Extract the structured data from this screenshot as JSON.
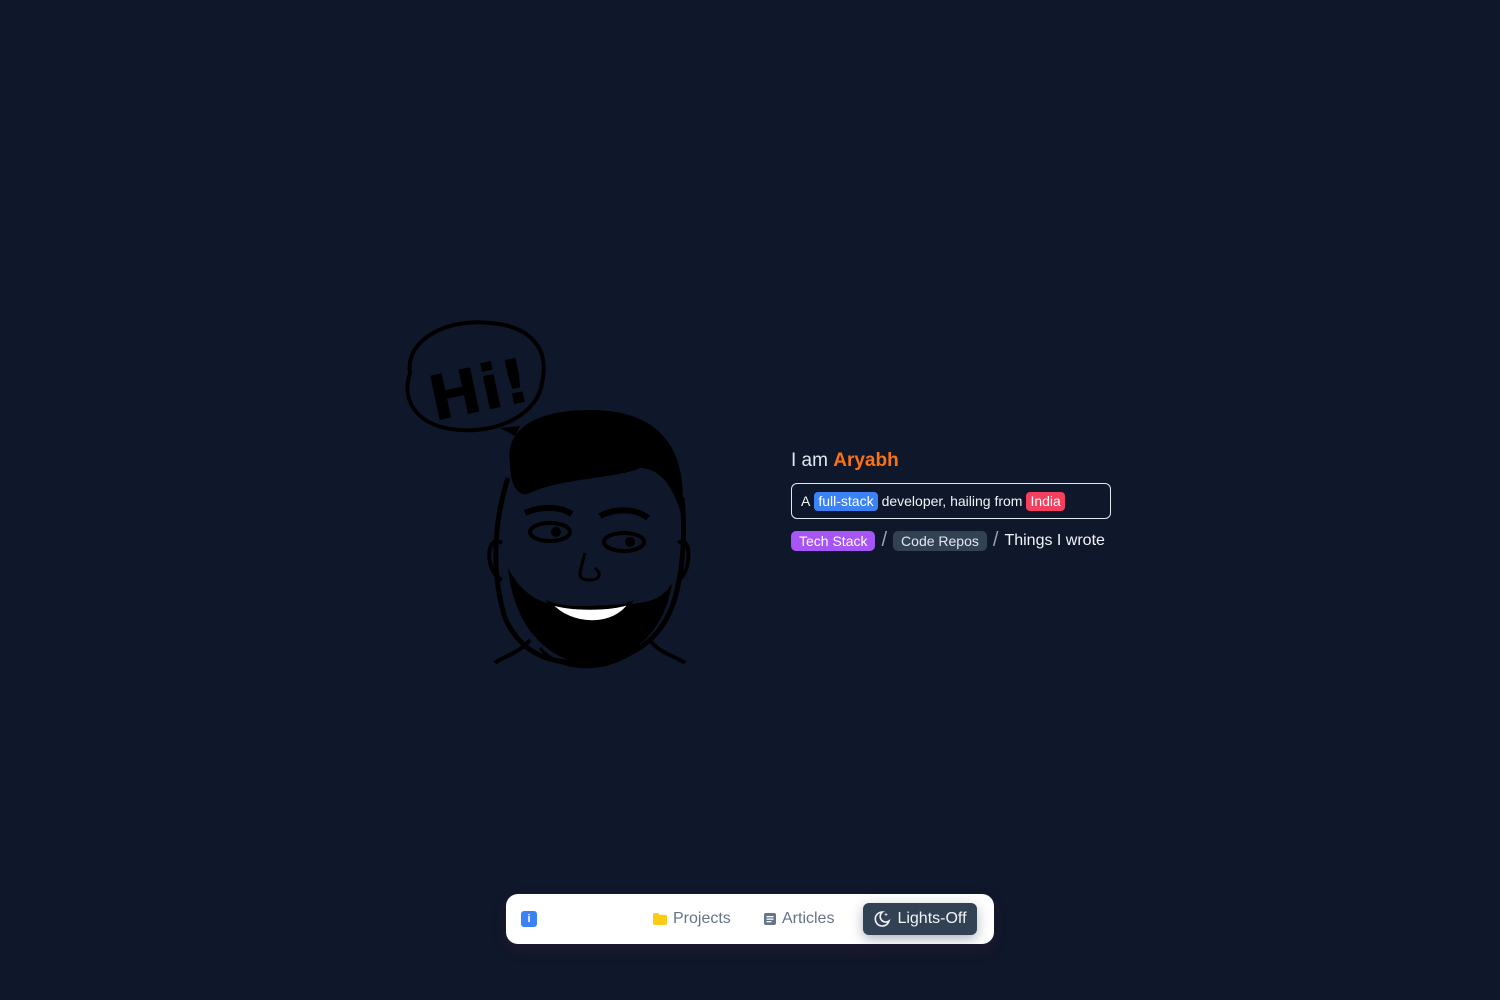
{
  "hero": {
    "greeting_prefix": "I am",
    "name": "Aryabh",
    "tagline": {
      "prefix": "A",
      "role": "full-stack",
      "middle": "developer, hailing from",
      "country": "India"
    },
    "links": {
      "tech_stack": "Tech Stack",
      "code_repos": "Code Repos",
      "things_i_wrote": "Things I wrote",
      "separator": "/"
    },
    "illustration_text": "Hi!"
  },
  "dock": {
    "info_icon": "i",
    "projects_label": "Projects",
    "articles_label": "Articles",
    "lights_label": "Lights-Off"
  },
  "colors": {
    "background": "#0f172a",
    "name_accent": "#f97316",
    "role_chip": "#3b82f6",
    "country_chip": "#f43f5e",
    "tech_stack_tag": "#a855f7",
    "code_repos_tag": "#334155",
    "folder_icon": "#facc15"
  },
  "icons": [
    "info-icon",
    "folder-icon",
    "document-icon",
    "moon-icon"
  ]
}
